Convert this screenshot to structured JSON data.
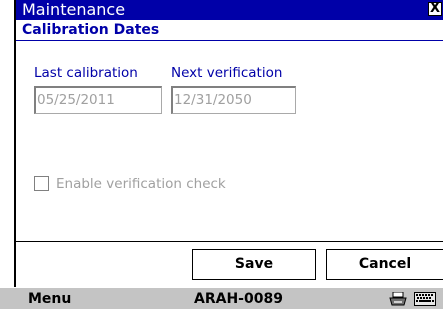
{
  "window": {
    "title": "Maintenance",
    "close_label": "X"
  },
  "section": {
    "title": "Calibration Dates"
  },
  "fields": {
    "last_calibration": {
      "label": "Last calibration",
      "value": "05/25/2011"
    },
    "next_verification": {
      "label": "Next verification",
      "value": "12/31/2050"
    }
  },
  "checkbox": {
    "label": "Enable verification check",
    "checked": false
  },
  "buttons": {
    "save": "Save",
    "cancel": "Cancel"
  },
  "bottom_bar": {
    "menu": "Menu",
    "device_id": "ARAH-0089",
    "icons": [
      "printer-icon",
      "keyboard-icon"
    ]
  },
  "colors": {
    "title_bar": "#0000a8",
    "accent": "#0000a8",
    "disabled_text": "#a0a0a0",
    "bottom_bar": "#c4c4c4"
  }
}
